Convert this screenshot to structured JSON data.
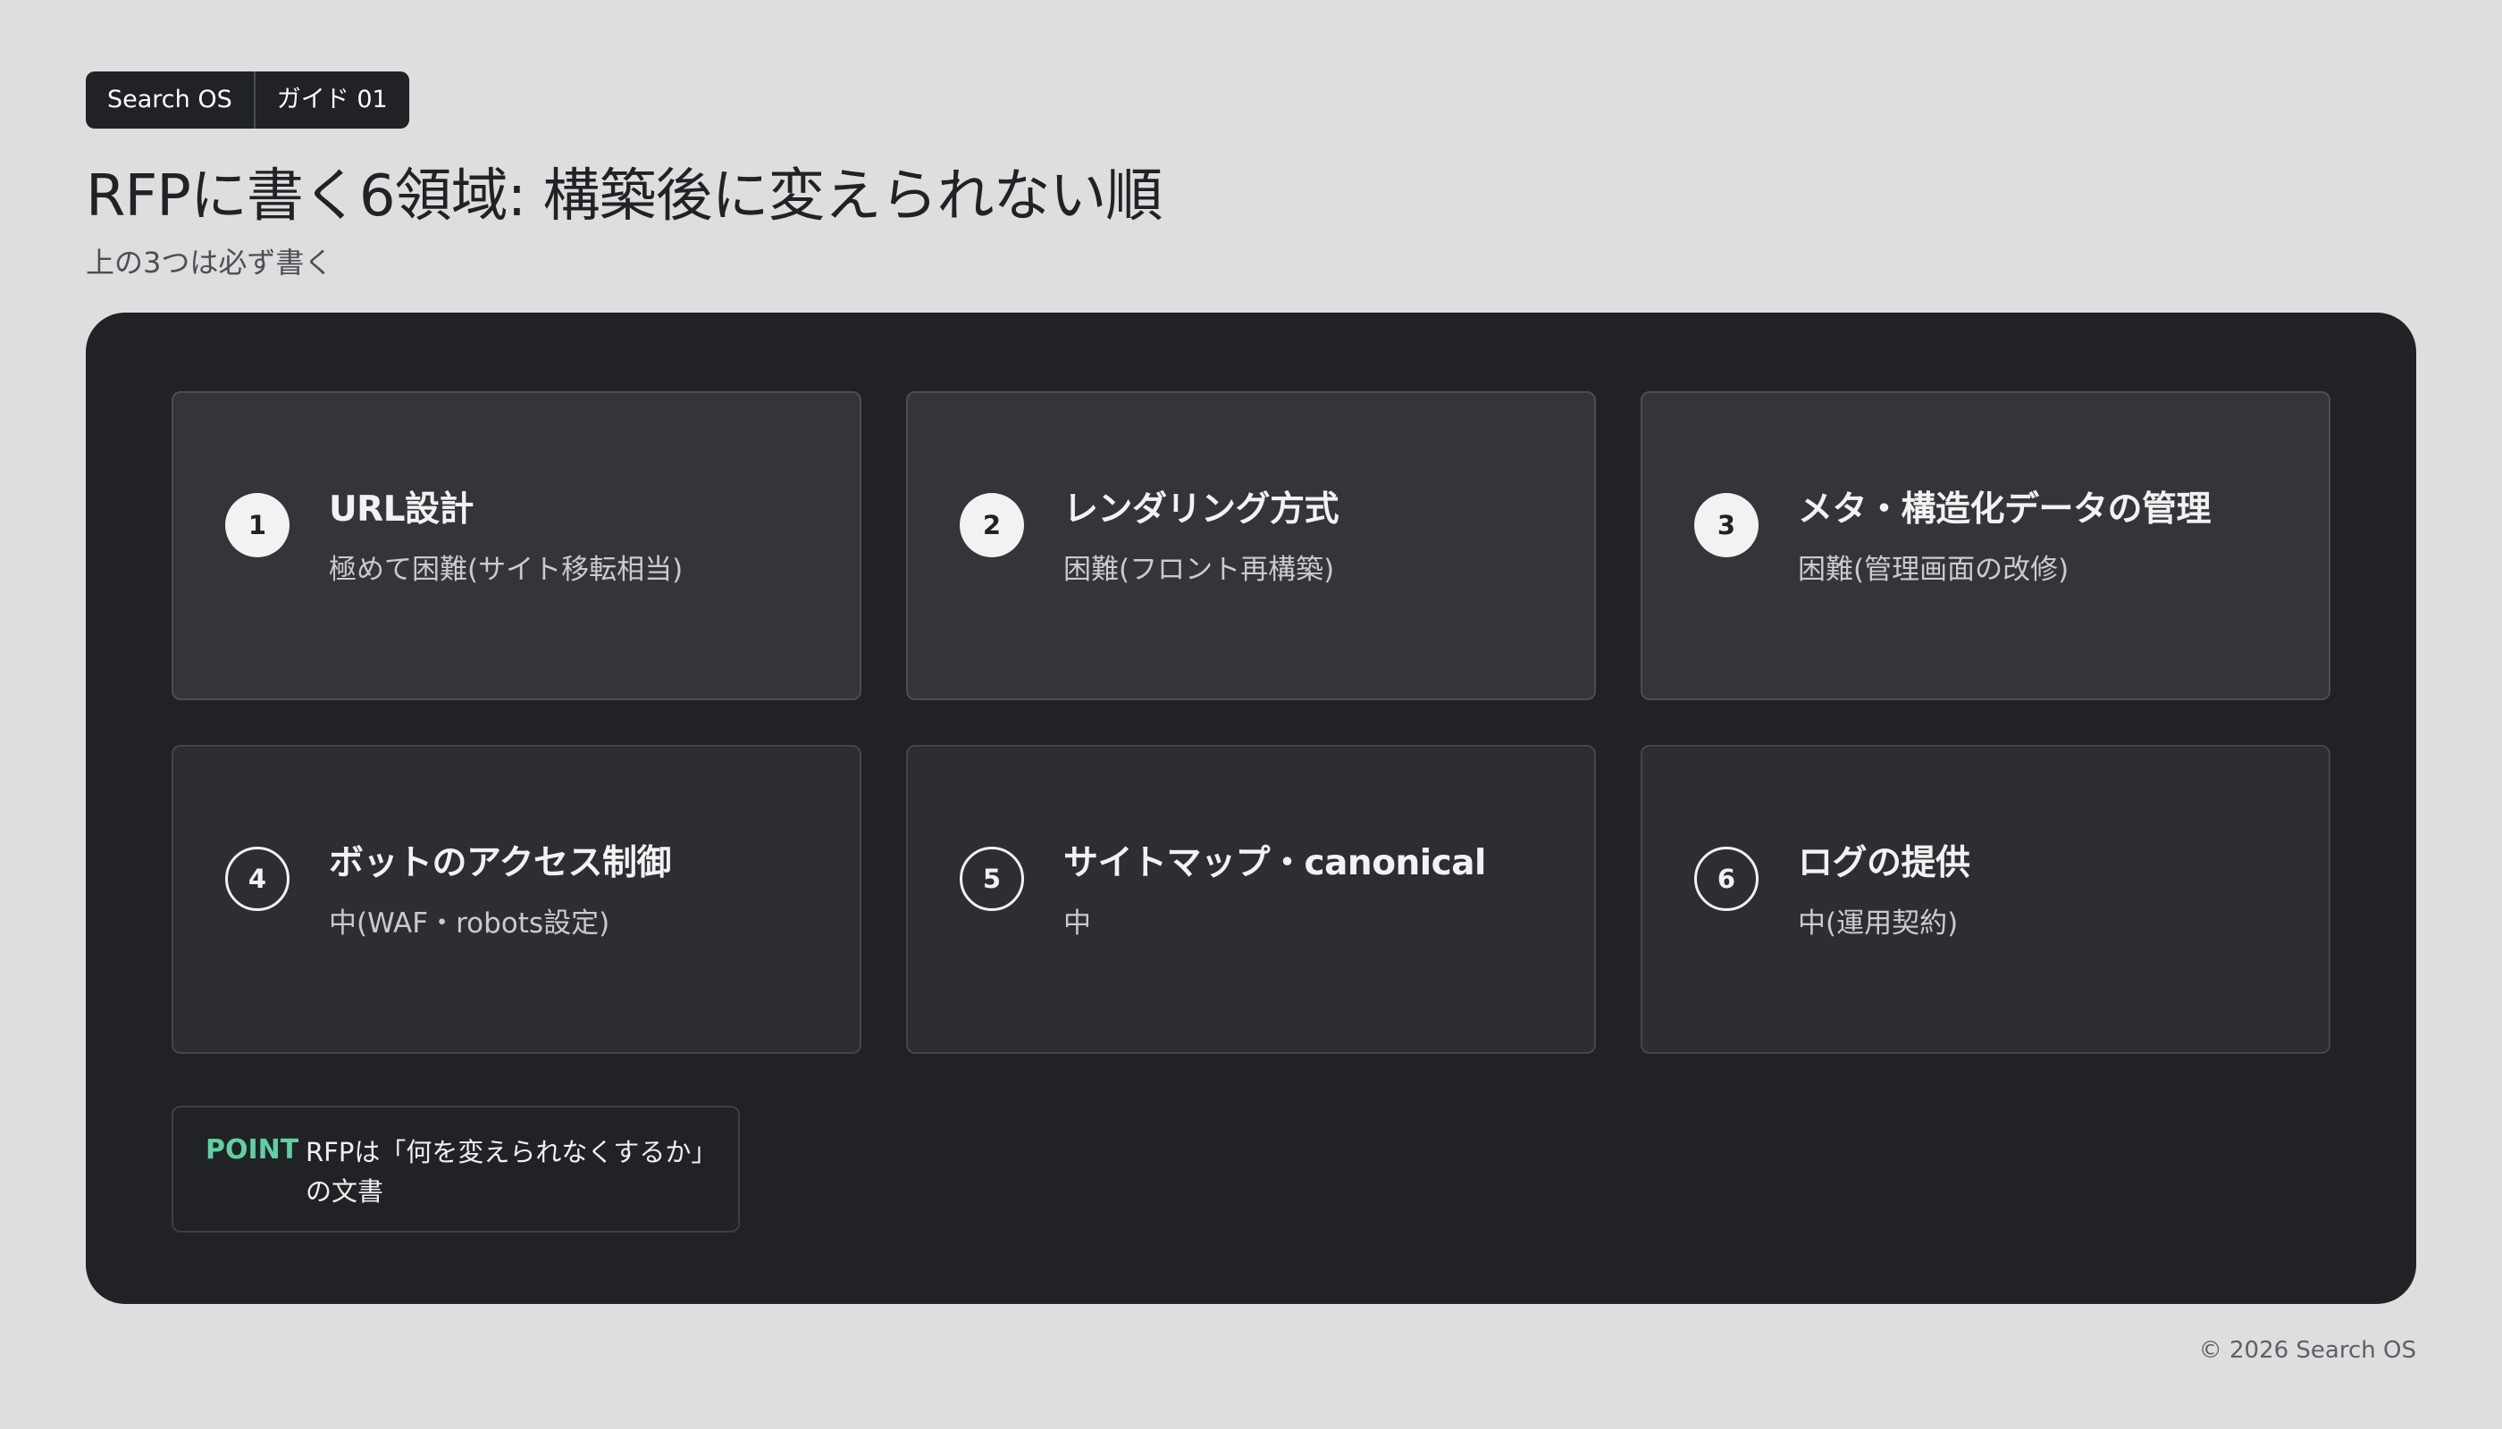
{
  "header": {
    "badge": [
      "Search OS",
      "ガイド 01"
    ],
    "title": "RFPに書く6領域: 構築後に変えられない順",
    "subtitle": "上の3つは必ず書く"
  },
  "cards": [
    {
      "number": "1",
      "title": "URL設計",
      "description": "極めて困難(サイト移転相当)"
    },
    {
      "number": "2",
      "title": "レンダリング方式",
      "description": "困難(フロント再構築)"
    },
    {
      "number": "3",
      "title": "メタ・構造化データの管理",
      "description": "困難(管理画面の改修)"
    },
    {
      "number": "4",
      "title": "ボットのアクセス制御",
      "description": "中(WAF・robots設定)"
    },
    {
      "number": "5",
      "title": "サイトマップ・canonical",
      "description": "中"
    },
    {
      "number": "6",
      "title": "ログの提供",
      "description": "中(運用契約)"
    }
  ],
  "point": {
    "label": "POINT",
    "text": "RFPは「何を変えられなくするか」の文書"
  },
  "footer": {
    "copyright": "© 2026 Search OS"
  },
  "colors": {
    "background": "#dedede",
    "panel": "#202226",
    "card_top": "#33353a",
    "card_bottom": "#2c2e33",
    "accent": "#5fd0a0"
  }
}
